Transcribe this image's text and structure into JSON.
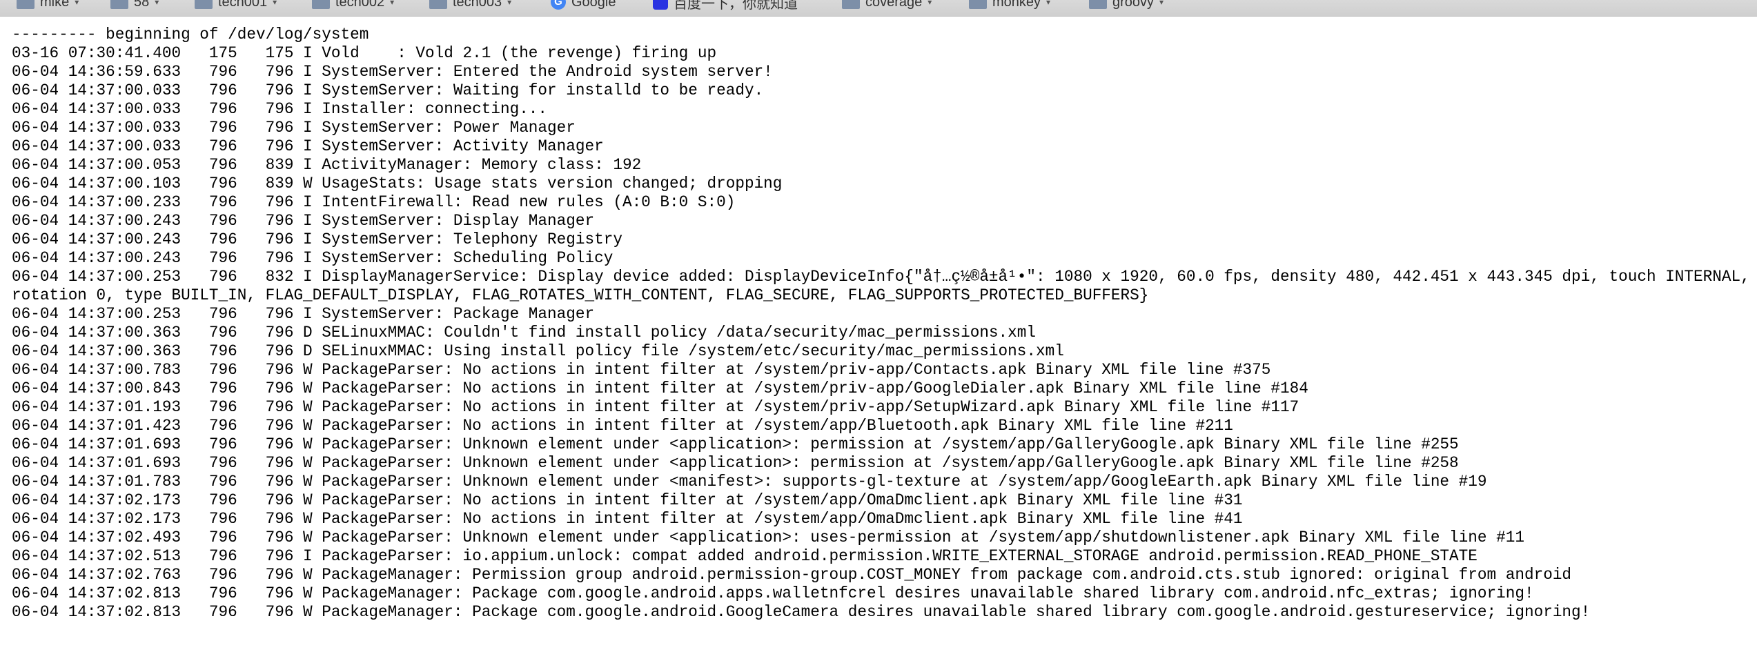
{
  "bookmarks": [
    {
      "label": "mike",
      "icon": "folder-icon",
      "has_chevron": true
    },
    {
      "label": "58",
      "icon": "folder-icon",
      "has_chevron": true
    },
    {
      "label": "tech001",
      "icon": "folder-icon",
      "has_chevron": true
    },
    {
      "label": "tech002",
      "icon": "folder-icon",
      "has_chevron": true
    },
    {
      "label": "tech003",
      "icon": "folder-icon",
      "has_chevron": true
    },
    {
      "label": "Google",
      "icon": "google-icon",
      "has_chevron": false
    },
    {
      "label": "百度一下，你就知道",
      "icon": "baidu-icon",
      "has_chevron": false
    },
    {
      "label": "coverage",
      "icon": "folder-icon",
      "has_chevron": true
    },
    {
      "label": "monkey",
      "icon": "folder-icon",
      "has_chevron": true
    },
    {
      "label": "groovy",
      "icon": "folder-icon",
      "has_chevron": true
    }
  ],
  "log": {
    "header": "--------- beginning of /dev/log/system",
    "lines": [
      "03-16 07:30:41.400   175   175 I Vold    : Vold 2.1 (the revenge) firing up",
      "06-04 14:36:59.633   796   796 I SystemServer: Entered the Android system server!",
      "06-04 14:37:00.033   796   796 I SystemServer: Waiting for installd to be ready.",
      "06-04 14:37:00.033   796   796 I Installer: connecting...",
      "06-04 14:37:00.033   796   796 I SystemServer: Power Manager",
      "06-04 14:37:00.033   796   796 I SystemServer: Activity Manager",
      "06-04 14:37:00.053   796   839 I ActivityManager: Memory class: 192",
      "06-04 14:37:00.103   796   839 W UsageStats: Usage stats version changed; dropping",
      "06-04 14:37:00.233   796   796 I IntentFirewall: Read new rules (A:0 B:0 S:0)",
      "06-04 14:37:00.243   796   796 I SystemServer: Display Manager",
      "06-04 14:37:00.243   796   796 I SystemServer: Telephony Registry",
      "06-04 14:37:00.243   796   796 I SystemServer: Scheduling Policy",
      "06-04 14:37:00.253   796   832 I DisplayManagerService: Display device added: DisplayDeviceInfo{\"å†…ç½®å±å¹•\": 1080 x 1920, 60.0 fps, density 480, 442.451 x 443.345 dpi, touch INTERNAL, rotation 0, type BUILT_IN, FLAG_DEFAULT_DISPLAY, FLAG_ROTATES_WITH_CONTENT, FLAG_SECURE, FLAG_SUPPORTS_PROTECTED_BUFFERS}",
      "06-04 14:37:00.253   796   796 I SystemServer: Package Manager",
      "06-04 14:37:00.363   796   796 D SELinuxMMAC: Couldn't find install policy /data/security/mac_permissions.xml",
      "06-04 14:37:00.363   796   796 D SELinuxMMAC: Using install policy file /system/etc/security/mac_permissions.xml",
      "06-04 14:37:00.783   796   796 W PackageParser: No actions in intent filter at /system/priv-app/Contacts.apk Binary XML file line #375",
      "06-04 14:37:00.843   796   796 W PackageParser: No actions in intent filter at /system/priv-app/GoogleDialer.apk Binary XML file line #184",
      "06-04 14:37:01.193   796   796 W PackageParser: No actions in intent filter at /system/priv-app/SetupWizard.apk Binary XML file line #117",
      "06-04 14:37:01.423   796   796 W PackageParser: No actions in intent filter at /system/app/Bluetooth.apk Binary XML file line #211",
      "06-04 14:37:01.693   796   796 W PackageParser: Unknown element under <application>: permission at /system/app/GalleryGoogle.apk Binary XML file line #255",
      "06-04 14:37:01.693   796   796 W PackageParser: Unknown element under <application>: permission at /system/app/GalleryGoogle.apk Binary XML file line #258",
      "06-04 14:37:01.783   796   796 W PackageParser: Unknown element under <manifest>: supports-gl-texture at /system/app/GoogleEarth.apk Binary XML file line #19",
      "06-04 14:37:02.173   796   796 W PackageParser: No actions in intent filter at /system/app/OmaDmclient.apk Binary XML file line #31",
      "06-04 14:37:02.173   796   796 W PackageParser: No actions in intent filter at /system/app/OmaDmclient.apk Binary XML file line #41",
      "06-04 14:37:02.493   796   796 W PackageParser: Unknown element under <application>: uses-permission at /system/app/shutdownlistener.apk Binary XML file line #11",
      "06-04 14:37:02.513   796   796 I PackageParser: io.appium.unlock: compat added android.permission.WRITE_EXTERNAL_STORAGE android.permission.READ_PHONE_STATE",
      "06-04 14:37:02.763   796   796 W PackageManager: Permission group android.permission-group.COST_MONEY from package com.android.cts.stub ignored: original from android",
      "06-04 14:37:02.813   796   796 W PackageManager: Package com.google.android.apps.walletnfcrel desires unavailable shared library com.android.nfc_extras; ignoring!",
      "06-04 14:37:02.813   796   796 W PackageManager: Package com.google.android.GoogleCamera desires unavailable shared library com.google.android.gestureservice; ignoring!"
    ]
  }
}
